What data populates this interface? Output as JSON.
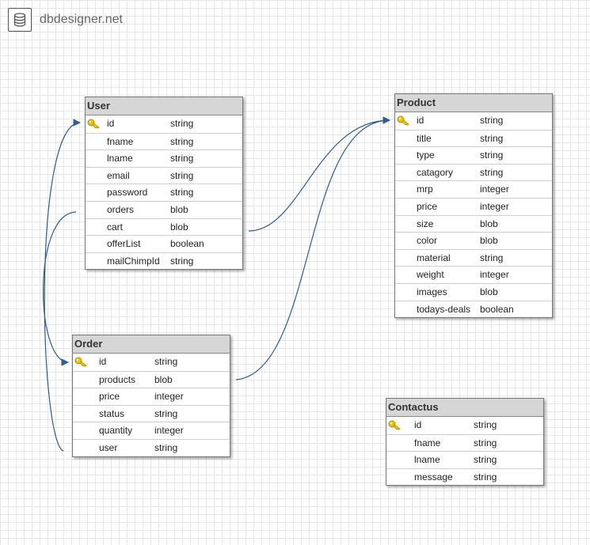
{
  "brand": {
    "name": "dbdesigner.net",
    "icon": "database-icon"
  },
  "colors": {
    "link": "#2f5d8c",
    "header": "#d6d6d6",
    "key": "#e6b800"
  },
  "tables": [
    {
      "name": "User",
      "fields": [
        {
          "name": "id",
          "type": "string",
          "primary": true
        },
        {
          "name": "fname",
          "type": "string"
        },
        {
          "name": "lname",
          "type": "string"
        },
        {
          "name": "email",
          "type": "string"
        },
        {
          "name": "password",
          "type": "string"
        },
        {
          "name": "orders",
          "type": "blob"
        },
        {
          "name": "cart",
          "type": "blob"
        },
        {
          "name": "offerList",
          "type": "boolean"
        },
        {
          "name": "mailChimpId",
          "type": "string"
        }
      ]
    },
    {
      "name": "Product",
      "fields": [
        {
          "name": "id",
          "type": "string",
          "primary": true
        },
        {
          "name": "title",
          "type": "string"
        },
        {
          "name": "type",
          "type": "string"
        },
        {
          "name": "catagory",
          "type": "string"
        },
        {
          "name": "mrp",
          "type": "integer"
        },
        {
          "name": "price",
          "type": "integer"
        },
        {
          "name": "size",
          "type": "blob"
        },
        {
          "name": "color",
          "type": "blob"
        },
        {
          "name": "material",
          "type": "string"
        },
        {
          "name": "weight",
          "type": "integer"
        },
        {
          "name": "images",
          "type": "blob"
        },
        {
          "name": "todays-deals",
          "type": "boolean"
        }
      ]
    },
    {
      "name": "Order",
      "fields": [
        {
          "name": "id",
          "type": "string",
          "primary": true
        },
        {
          "name": "products",
          "type": "blob"
        },
        {
          "name": "price",
          "type": "integer"
        },
        {
          "name": "status",
          "type": "string"
        },
        {
          "name": "quantity",
          "type": "integer"
        },
        {
          "name": "user",
          "type": "string"
        }
      ]
    },
    {
      "name": "Contactus",
      "fields": [
        {
          "name": "id",
          "type": "string",
          "primary": true
        },
        {
          "name": "fname",
          "type": "string"
        },
        {
          "name": "lname",
          "type": "string"
        },
        {
          "name": "message",
          "type": "string"
        }
      ]
    }
  ],
  "relations": [
    {
      "from": "User.cart",
      "to": "Product.id"
    },
    {
      "from": "Order.products",
      "to": "Product.id"
    },
    {
      "from": "User.orders",
      "to": "Order.id"
    },
    {
      "from": "Order.user",
      "to": "User.id"
    }
  ]
}
